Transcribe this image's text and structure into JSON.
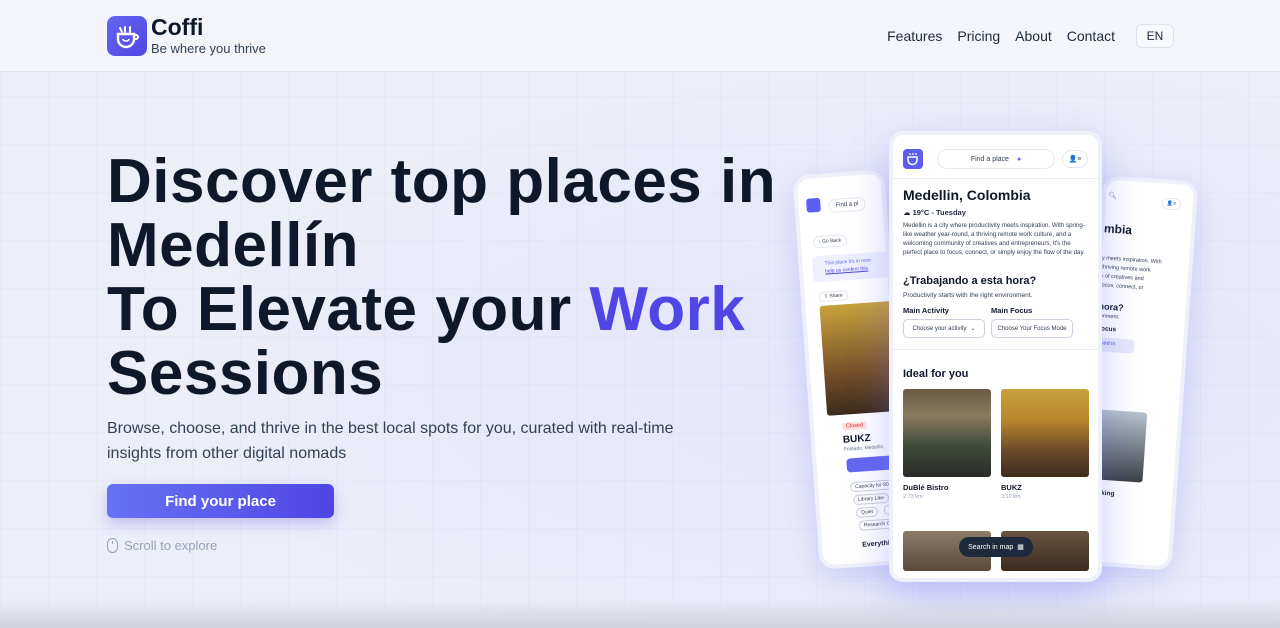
{
  "header": {
    "brand": "Coffi",
    "tagline": "Be where you thrive",
    "nav": [
      "Features",
      "Pricing",
      "About",
      "Contact"
    ],
    "language": "EN"
  },
  "hero": {
    "title_line1": "Discover top places in",
    "title_line2": "Medellín",
    "title_line3_prefix": "To Elevate your ",
    "title_line3_accent": "Work",
    "title_line4": "Sessions",
    "subtitle": "Browse, choose, and thrive in the best local spots for you, curated with real-time insights from other digital nomads",
    "cta": "Find your place",
    "scroll_hint": "Scroll to explore"
  },
  "phone": {
    "search": "Find a place",
    "city": "Medellin, Colombia",
    "weather": "19°C - Tuesday",
    "description": "Medellin is a city where productivity meets inspiration. With spring-like weather year-round, a thriving remote work culture, and a welcoming community of creatives and entrepreneurs, it's the perfect place to focus, connect, or simply enjoy the flow of the day.",
    "question": "¿Trabajando a esta hora?",
    "question_sub": "Productivity starts with the right environment.",
    "main_activity_label": "Main Activity",
    "main_focus_label": "Main Focus",
    "activity_select": "Choose your activity",
    "focus_select": "Choose Your Focus Mode",
    "ideal_heading": "Ideal for you",
    "cards": [
      {
        "name": "DuBlé Bistro",
        "distance": "2.73 km"
      },
      {
        "name": "BUKZ",
        "distance": "3.10 km"
      }
    ],
    "map_button": "Search in map"
  },
  "left_phone": {
    "search": "Find a pl",
    "back": "Go Back",
    "notice_1": "This place it's in rece",
    "notice_2": "help us confirm this",
    "share": "Share",
    "status": "Closed",
    "name": "BUKZ",
    "location": "Poblado, Medellin,",
    "tags": [
      "Capacity for 80",
      "Library Like",
      "Quiet",
      "Co",
      "Research Cen"
    ],
    "footer": "Everything"
  },
  "right_phone": {
    "city_partial": "mbia",
    "desc_1": "y meets inspiration. With",
    "desc_2": "thriving remote work",
    "desc_3": "y of creatives and",
    "desc_4": "focus, connect, or",
    "q_partial": "hora?",
    "q_sub": "ronment.",
    "focus_label": "Focus",
    "checked": "cked in",
    "coworking": "oworking"
  },
  "colors": {
    "accent": "#4f46e5",
    "text": "#0f172a",
    "background": "#eceef8"
  }
}
